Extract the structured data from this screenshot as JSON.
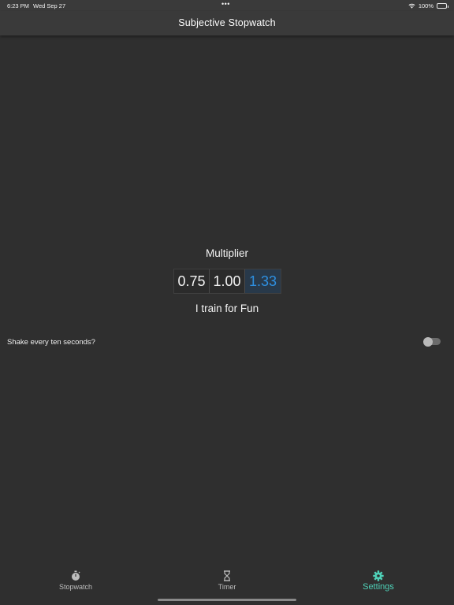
{
  "status_bar": {
    "time": "6:23 PM",
    "date": "Wed Sep 27",
    "dots": "•••",
    "battery": "100%"
  },
  "nav": {
    "title": "Subjective Stopwatch"
  },
  "settings": {
    "multiplier_label": "Multiplier",
    "multiplier_options": [
      "0.75",
      "1.00",
      "1.33"
    ],
    "selected_multiplier": "1.33",
    "train_text": "I train for Fun",
    "shake_label": "Shake every ten seconds?",
    "shake_enabled": false
  },
  "tabs": [
    {
      "label": "Stopwatch",
      "icon": "stopwatch-icon"
    },
    {
      "label": "Timer",
      "icon": "hourglass-icon"
    },
    {
      "label": "Settings",
      "icon": "gear-icon",
      "active": true
    }
  ],
  "colors": {
    "background": "#2f2f2f",
    "bar": "#3a3a3a",
    "selected_segment_text": "#2e8fe0",
    "active_tab": "#4fd1b8"
  }
}
